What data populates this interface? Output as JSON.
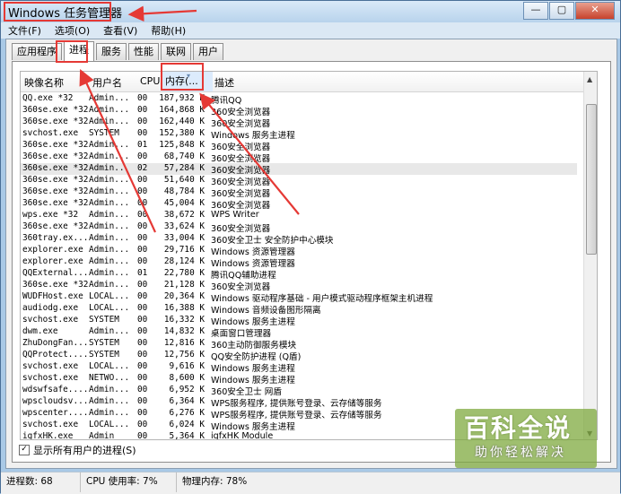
{
  "window": {
    "title": "Windows 任务管理器",
    "controls": [
      "—",
      "▢",
      "✕"
    ]
  },
  "menu": [
    "文件(F)",
    "选项(O)",
    "查看(V)",
    "帮助(H)"
  ],
  "tabs": [
    "应用程序",
    "进程",
    "服务",
    "性能",
    "联网",
    "用户"
  ],
  "active_tab": "进程",
  "table": {
    "headers": {
      "name": "映像名称",
      "user": "用户名",
      "cpu": "CPU",
      "mem": "内存(...",
      "desc": "描述"
    },
    "rows": [
      [
        "QQ.exe *32",
        "Admin...",
        "00",
        "187,932 K",
        "腾讯QQ"
      ],
      [
        "360se.exe *32",
        "Admin...",
        "00",
        "164,868 K",
        "360安全浏览器"
      ],
      [
        "360se.exe *32",
        "Admin...",
        "00",
        "162,440 K",
        "360安全浏览器"
      ],
      [
        "svchost.exe",
        "SYSTEM",
        "00",
        "152,380 K",
        "Windows 服务主进程"
      ],
      [
        "360se.exe *32",
        "Admin...",
        "01",
        "125,848 K",
        "360安全浏览器"
      ],
      [
        "360se.exe *32",
        "Admin...",
        "00",
        "68,740 K",
        "360安全浏览器"
      ],
      [
        "360se.exe *32",
        "Admin...",
        "02",
        "57,284 K",
        "360安全浏览器"
      ],
      [
        "360se.exe *32",
        "Admin...",
        "00",
        "51,640 K",
        "360安全浏览器"
      ],
      [
        "360se.exe *32",
        "Admin...",
        "00",
        "48,784 K",
        "360安全浏览器"
      ],
      [
        "360se.exe *32",
        "Admin...",
        "00",
        "45,004 K",
        "360安全浏览器"
      ],
      [
        "wps.exe *32",
        "Admin...",
        "00",
        "38,672 K",
        "WPS Writer"
      ],
      [
        "360se.exe *32",
        "Admin...",
        "00",
        "33,624 K",
        "360安全浏览器"
      ],
      [
        "360tray.ex...",
        "Admin...",
        "00",
        "33,004 K",
        "360安全卫士 安全防护中心模块"
      ],
      [
        "explorer.exe",
        "Admin...",
        "00",
        "29,716 K",
        "Windows 资源管理器"
      ],
      [
        "explorer.exe",
        "Admin...",
        "00",
        "28,124 K",
        "Windows 资源管理器"
      ],
      [
        "QQExternal...",
        "Admin...",
        "01",
        "22,780 K",
        "腾讯QQ辅助进程"
      ],
      [
        "360se.exe *32",
        "Admin...",
        "00",
        "21,128 K",
        "360安全浏览器"
      ],
      [
        "WUDFHost.exe",
        "LOCAL...",
        "00",
        "20,364 K",
        "Windows 驱动程序基础 - 用户模式驱动程序框架主机进程"
      ],
      [
        "audiodg.exe",
        "LOCAL...",
        "00",
        "16,388 K",
        "Windows 音频设备图形隔离"
      ],
      [
        "svchost.exe",
        "SYSTEM",
        "00",
        "16,332 K",
        "Windows 服务主进程"
      ],
      [
        "dwm.exe",
        "Admin...",
        "00",
        "14,832 K",
        "桌面窗口管理器"
      ],
      [
        "ZhuDongFan...",
        "SYSTEM",
        "00",
        "12,816 K",
        "360主动防御服务模块"
      ],
      [
        "QQProtect....",
        "SYSTEM",
        "00",
        "12,756 K",
        "QQ安全防护进程 (Q盾)"
      ],
      [
        "svchost.exe",
        "LOCAL...",
        "00",
        "9,616 K",
        "Windows 服务主进程"
      ],
      [
        "svchost.exe",
        "NETWO...",
        "00",
        "8,600 K",
        "Windows 服务主进程"
      ],
      [
        "wdswfsafe....",
        "Admin...",
        "00",
        "6,952 K",
        "360安全卫士 网盾"
      ],
      [
        "wpscloudsv...",
        "Admin...",
        "00",
        "6,364 K",
        "WPS服务程序, 提供账号登录、云存储等服务"
      ],
      [
        "wpscenter....",
        "Admin...",
        "00",
        "6,276 K",
        "WPS服务程序, 提供账号登录、云存储等服务"
      ],
      [
        "svchost.exe",
        "LOCAL...",
        "00",
        "6,024 K",
        "Windows 服务主进程"
      ],
      [
        "igfxHK.exe",
        "Admin",
        "00",
        "5,364 K",
        "igfxHK Module"
      ]
    ],
    "selected_row": 6
  },
  "show_all_users": {
    "label": "显示所有用户的进程(S)",
    "checked": true
  },
  "status": {
    "processes": "进程数: 68",
    "cpu": "CPU 使用率: 7%",
    "memory": "物理内存: 78%"
  },
  "watermark": {
    "big": "百科全说",
    "small": "助你轻松解决"
  },
  "colors": {
    "highlight": "#e53935",
    "titlebar": "#c8ddf1"
  }
}
